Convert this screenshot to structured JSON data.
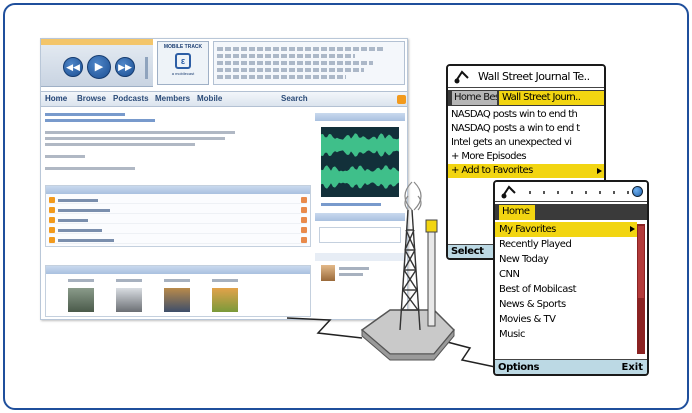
{
  "web": {
    "nav": [
      "Home",
      "Browse",
      "Podcasts",
      "Members",
      "Mobile",
      "Search"
    ],
    "logo_title": "MOBILE TRACK",
    "logo_sub": "a mobilecast"
  },
  "phone1": {
    "title": "Wall Street Journal Te..",
    "tab_home": "Home Best",
    "tab_active": "Wall Street Journ..",
    "items": [
      "NASDAQ posts win to end th",
      "NASDAQ posts a win to end t",
      "Intel gets an unexpected vi",
      "+ More Episodes",
      "+ Add to Favorites"
    ],
    "selected_index": 4,
    "softkey_left": "Select"
  },
  "phone2": {
    "tab_home": "Home",
    "items": [
      "My Favorites",
      "Recently Played",
      "New Today",
      "CNN",
      "Best of Mobilcast",
      "News & Sports",
      "Movies & TV",
      "Music"
    ],
    "selected_index": 0,
    "softkey_left": "Options",
    "softkey_right": "Exit"
  },
  "colors": {
    "frame_border": "#1f4f9c",
    "highlight": "#f2d511",
    "softkey_bar": "#bcd9e4",
    "tab_bar": "#3a3a3a",
    "waveform_bg": "#12303a",
    "waveform": "#3fbf8a"
  }
}
